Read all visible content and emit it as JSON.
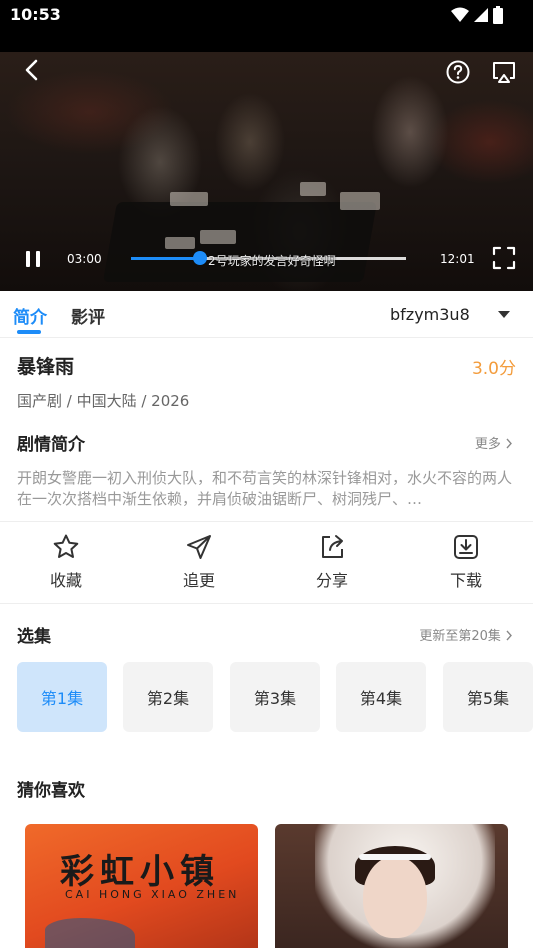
{
  "status_bar": {
    "time": "10:53"
  },
  "player": {
    "current_time": "03:00",
    "duration": "12:01",
    "progress": 0.25,
    "subtitle": "2号玩家的发言好奇怪啊"
  },
  "tabs": {
    "items": [
      {
        "label": "简介"
      },
      {
        "label": "影评"
      }
    ],
    "active": 0,
    "source_label": "bfzym3u8"
  },
  "info": {
    "title": "暴锋雨",
    "score": "3.0分",
    "meta": "国产剧 / 中国大陆 / 2026",
    "synopsis_heading": "剧情简介",
    "more_label": "更多",
    "synopsis": "开朗女警鹿一初入刑侦大队，和不苟言笑的林深针锋相对，水火不容的两人在一次次搭档中渐生依赖，并肩侦破油锯断尸、树洞残尸、…"
  },
  "actions": [
    {
      "label": "收藏",
      "icon": "star-icon"
    },
    {
      "label": "追更",
      "icon": "send-icon"
    },
    {
      "label": "分享",
      "icon": "share-icon"
    },
    {
      "label": "下载",
      "icon": "download-icon"
    }
  ],
  "episodes": {
    "heading": "选集",
    "update_label": "更新至第20集",
    "items": [
      {
        "label": "第1集"
      },
      {
        "label": "第2集"
      },
      {
        "label": "第3集"
      },
      {
        "label": "第4集"
      },
      {
        "label": "第5集"
      }
    ],
    "active": 0
  },
  "recommend": {
    "heading": "猜你喜欢",
    "posters": [
      {
        "title": "彩虹小镇",
        "subtitle": "CAI HONG XIAO ZHEN"
      },
      {
        "title": ""
      }
    ]
  },
  "colors": {
    "accent": "#1d8cf8",
    "score": "#f39c3c"
  }
}
